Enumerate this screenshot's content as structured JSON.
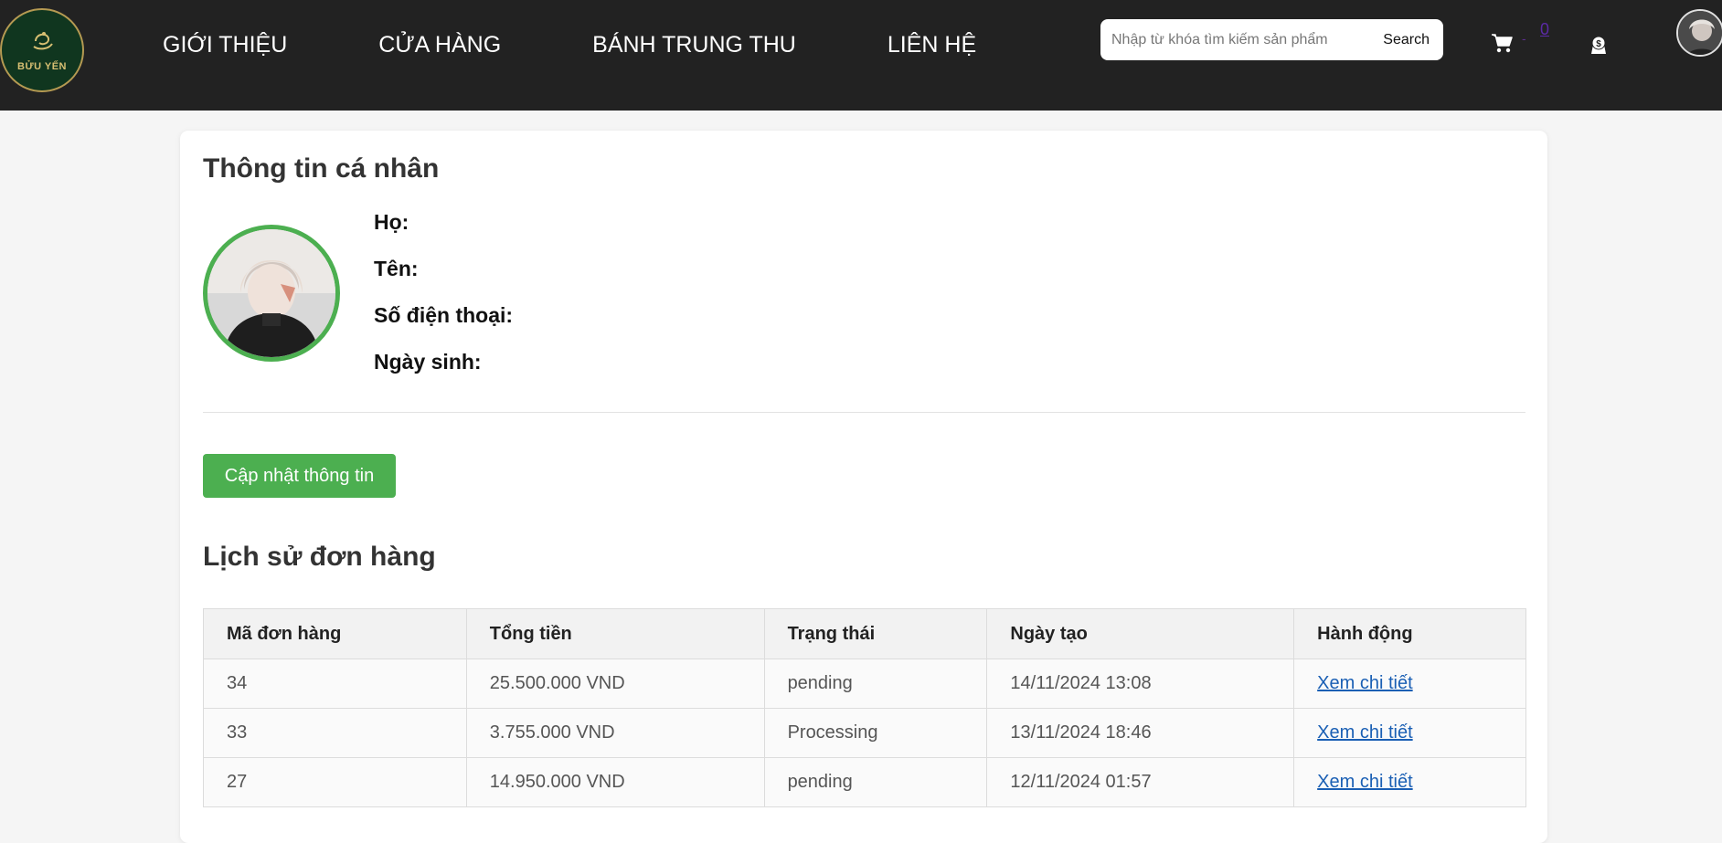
{
  "header": {
    "logo_text": "BỬU YẾN",
    "nav": [
      {
        "label": "GIỚI THIỆU"
      },
      {
        "label": "CỬA HÀNG"
      },
      {
        "label": "BÁNH TRUNG THU"
      },
      {
        "label": "LIÊN HỆ"
      }
    ],
    "search": {
      "placeholder": "Nhập từ khóa tìm kiếm sản phẩm",
      "value": "",
      "button_label": "Search"
    },
    "cart": {
      "icon": "shopping-cart-icon",
      "separator": "-",
      "count": "0"
    },
    "dollar_icon": "dollar-badge-icon",
    "avatar_icon": "user-avatar"
  },
  "profile": {
    "title": "Thông tin cá nhân",
    "fields": [
      {
        "label": "Họ:",
        "value": ""
      },
      {
        "label": "Tên:",
        "value": ""
      },
      {
        "label": "Số điện thoại:",
        "value": ""
      },
      {
        "label": "Ngày sinh:",
        "value": ""
      }
    ],
    "update_button": "Cập nhật thông tin",
    "accent_color": "#4caf50"
  },
  "orders": {
    "title": "Lịch sử đơn hàng",
    "columns": [
      "Mã đơn hàng",
      "Tổng tiền",
      "Trạng thái",
      "Ngày tạo",
      "Hành động"
    ],
    "rows": [
      {
        "id": "34",
        "total": "25.500.000 VND",
        "status": "pending",
        "created": "14/11/2024 13:08",
        "action": "Xem chi tiết"
      },
      {
        "id": "33",
        "total": "3.755.000 VND",
        "status": "Processing",
        "created": "13/11/2024 18:46",
        "action": "Xem chi tiết"
      },
      {
        "id": "27",
        "total": "14.950.000 VND",
        "status": "pending",
        "created": "12/11/2024 01:57",
        "action": "Xem chi tiết"
      }
    ]
  }
}
